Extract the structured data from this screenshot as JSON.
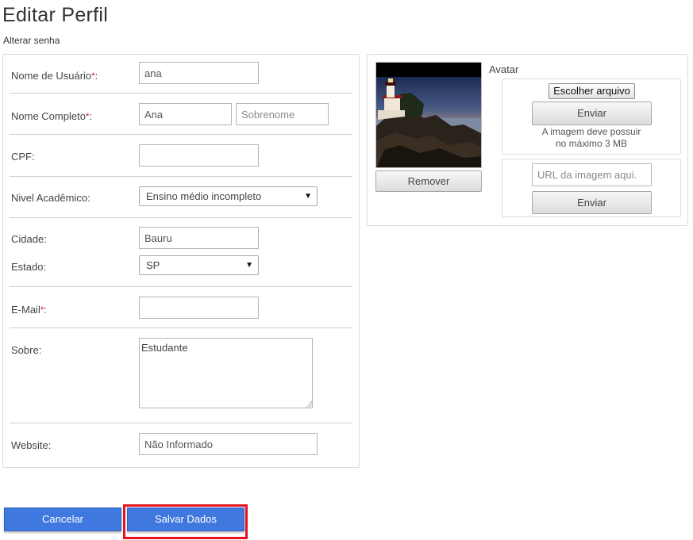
{
  "page": {
    "title": "Editar Perfil",
    "change_password_link": "Alterar senha"
  },
  "form": {
    "username": {
      "label": "Nome de Usuário",
      "required_mark": "*",
      "suffix": ":",
      "value": "ana"
    },
    "full_name": {
      "label": "Nome Completo",
      "required_mark": "*",
      "suffix": ":",
      "first_value": "Ana",
      "last_placeholder": "Sobrenome"
    },
    "cpf": {
      "label": "CPF:",
      "value": ""
    },
    "academic_level": {
      "label": "Nivel Acadêmico:",
      "value": "Ensino médio incompleto"
    },
    "city": {
      "label": "Cidade:",
      "value": "Bauru"
    },
    "state": {
      "label": "Estado:",
      "value": "SP"
    },
    "email": {
      "label": "E-Mail",
      "required_mark": "*",
      "suffix": ":",
      "value": ""
    },
    "about": {
      "label": "Sobre:",
      "value": "Estudante"
    },
    "website": {
      "label": "Website:",
      "value": "Não Informado"
    }
  },
  "avatar": {
    "label": "Avatar",
    "remove_button": "Remover",
    "choose_file_button": "Escolher arquivo",
    "upload_send_button": "Enviar",
    "size_note_line1": "A imagem deve possuir",
    "size_note_line2": "no máximo 3 MB",
    "url_placeholder": "URL da imagem aqui.",
    "url_send_button": "Enviar"
  },
  "actions": {
    "cancel_button": "Cancelar",
    "save_button": "Salvar Dados"
  },
  "colors": {
    "primary_button": "#3f78de",
    "highlight_border": "#e4141f",
    "required_mark": "#d9001b"
  }
}
